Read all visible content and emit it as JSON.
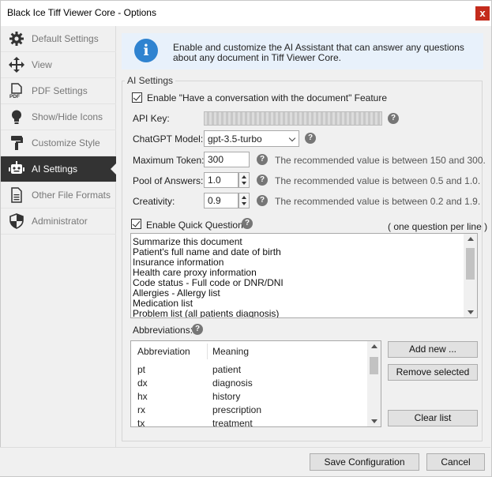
{
  "window": {
    "title": "Black Ice Tiff Viewer Core - Options",
    "close_glyph": "x"
  },
  "sidebar": {
    "items": [
      {
        "label": "Default Settings",
        "icon": "gear-icon"
      },
      {
        "label": "View",
        "icon": "move-arrows-icon"
      },
      {
        "label": "PDF Settings",
        "icon": "pdf-document-icon"
      },
      {
        "label": "Show/Hide Icons",
        "icon": "lightbulb-icon"
      },
      {
        "label": "Customize Style",
        "icon": "paint-roller-icon"
      },
      {
        "label": "AI Settings",
        "icon": "robot-icon",
        "active": true
      },
      {
        "label": "Other File Formats",
        "icon": "document-icon"
      },
      {
        "label": "Administrator",
        "icon": "shield-icon"
      }
    ]
  },
  "info": {
    "line1": "Enable and customize the AI Assistant that can answer any questions",
    "line2": "about any document in Tiff Viewer Core.",
    "icon": "i"
  },
  "ai": {
    "group_title": "AI Settings",
    "enable_conversation_label": "Enable \"Have a conversation with the document\" Feature",
    "enable_conversation_checked": true,
    "api_key_label": "API Key:",
    "model_label": "ChatGPT Model:",
    "model_value": "gpt-3.5-turbo",
    "max_token_label": "Maximum Token:",
    "max_token_value": "300",
    "max_token_hint": "The recommended value is between 150 and 300.",
    "pool_label": "Pool of Answers:",
    "pool_value": "1.0",
    "pool_hint": "The recommended value is between 0.5 and 1.0.",
    "creativity_label": "Creativity:",
    "creativity_value": "0.9",
    "creativity_hint": "The recommended value is between 0.2 and 1.9.",
    "help_glyph": "?",
    "quick_label": "Enable Quick Questions",
    "quick_checked": true,
    "quick_note": "( one question per line )",
    "questions": [
      "Summarize this document",
      "Patient's full name and date of birth",
      "Insurance information",
      "Health care proxy information",
      "Code status - Full code or DNR/DNI",
      "Allergies - Allergy list",
      "Medication list",
      "Problem list (all patients diagnosis)"
    ],
    "abbr_label": "Abbreviations:",
    "abbr_headers": {
      "abbreviation": "Abbreviation",
      "meaning": "Meaning"
    },
    "abbreviations": [
      {
        "abbr": "pt",
        "meaning": "patient"
      },
      {
        "abbr": "dx",
        "meaning": "diagnosis"
      },
      {
        "abbr": "hx",
        "meaning": "history"
      },
      {
        "abbr": "rx",
        "meaning": "prescription"
      },
      {
        "abbr": "tx",
        "meaning": "treatment"
      }
    ],
    "add_new": "Add new ...",
    "remove_selected": "Remove selected",
    "clear_list": "Clear list"
  },
  "footer": {
    "save": "Save Configuration",
    "cancel": "Cancel"
  },
  "colors": {
    "active_nav": "#333333",
    "info_bg": "#e8f1fb",
    "info_icon": "#2f83d0",
    "close": "#c42b1c"
  }
}
